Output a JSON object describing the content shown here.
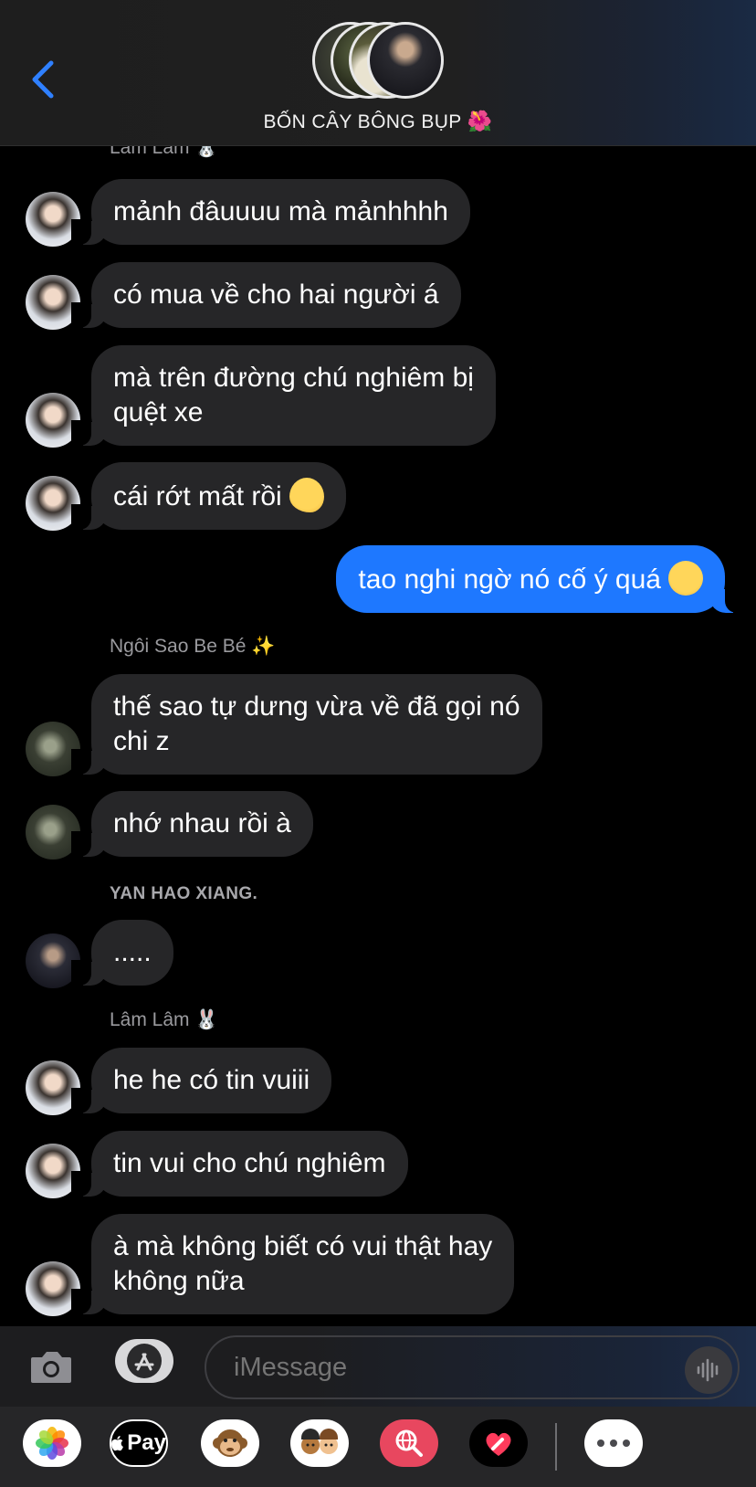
{
  "header": {
    "group_name": "BỐN CÂY BÔNG BỤP",
    "group_emoji": "🌺",
    "back_icon": "chevron-left-icon"
  },
  "messages": {
    "sender_lam_partial": "Lâm Lâm",
    "m1": "mảnh đâuuuu mà mảnhhhh",
    "m2": "có mua về cho hai người á",
    "m3_line1": "mà trên đường chú nghiêm bị",
    "m3_line2": "quệt xe",
    "m4": "cái rớt mất rồi",
    "m4_emoji": "melting-face-emoji",
    "out1": "tao nghi ngờ nó cố ý quá",
    "out1_emoji": "smiling-face-emoji",
    "sender_ngoi": "Ngôi Sao Be Bé",
    "sender_ngoi_emoji": "✨",
    "m5_line1": "thế sao tự dưng vừa về đã gọi nó",
    "m5_line2": "chi z",
    "m6": "nhớ nhau rồi à",
    "sender_yan": "YAN HAO XIANG.",
    "m7": ".....",
    "sender_lam": "Lâm Lâm",
    "sender_lam_emoji": "🐰",
    "m8": "he he có tin vuiii",
    "m9": "tin vui cho chú nghiêm",
    "m10_line1": "à mà không biết có vui thật hay",
    "m10_line2": "không nữa"
  },
  "input": {
    "placeholder": "iMessage",
    "camera_icon": "camera-icon",
    "appstore_icon": "app-store-icon",
    "voice_icon": "waveform-icon"
  },
  "apps": {
    "apple_pay_label": "Pay"
  },
  "colors": {
    "outgoing_bubble": "#1e78ff",
    "incoming_bubble": "#262628",
    "accent": "#2f80ff"
  }
}
